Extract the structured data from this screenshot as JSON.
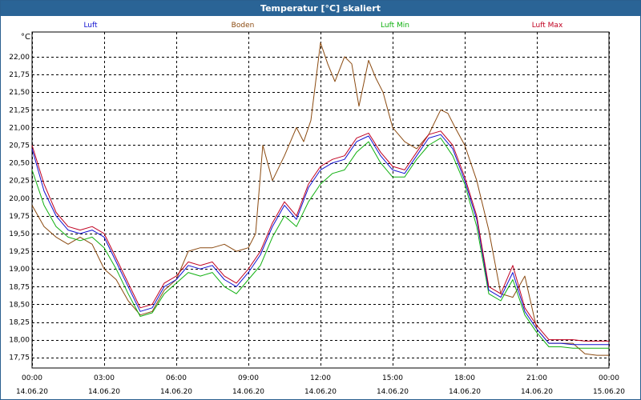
{
  "window": {
    "title": "Temperatur [°C] skaliert"
  },
  "colors": {
    "luft": "#1010d0",
    "boden": "#8b4a10",
    "luft_min": "#10b010",
    "luft_max": "#c00020"
  },
  "chart_data": {
    "type": "line",
    "title": "Temperatur [°C] skaliert",
    "ylabel": "°C",
    "xlabel": "",
    "ylim": [
      17.6,
      22.35
    ],
    "xlim": [
      0,
      24
    ],
    "grid": true,
    "legend": "top",
    "y_ticks": [
      "17,75",
      "18,00",
      "18,25",
      "18,50",
      "18,75",
      "19,00",
      "19,25",
      "19,50",
      "19,75",
      "20,00",
      "20,25",
      "20,50",
      "20,75",
      "21,00",
      "21,25",
      "21,50",
      "21,75",
      "22,00"
    ],
    "y_tick_values": [
      17.75,
      18.0,
      18.25,
      18.5,
      18.75,
      19.0,
      19.25,
      19.5,
      19.75,
      20.0,
      20.25,
      20.5,
      20.75,
      21.0,
      21.25,
      21.5,
      21.75,
      22.0
    ],
    "x_ticks": [
      {
        "x": 0,
        "time": "00:00",
        "date": "14.06.20"
      },
      {
        "x": 3,
        "time": "03:00",
        "date": "14.06.20"
      },
      {
        "x": 6,
        "time": "06:00",
        "date": "14.06.20"
      },
      {
        "x": 9,
        "time": "09:00",
        "date": "14.06.20"
      },
      {
        "x": 12,
        "time": "12:00",
        "date": "14.06.20"
      },
      {
        "x": 15,
        "time": "15:00",
        "date": "14.06.20"
      },
      {
        "x": 18,
        "time": "18:00",
        "date": "14.06.20"
      },
      {
        "x": 21,
        "time": "21:00",
        "date": "14.06.20"
      },
      {
        "x": 24,
        "time": "00:00",
        "date": "15.06.20"
      }
    ],
    "series": [
      {
        "name": "Luft",
        "color": "#1010d0",
        "x": [
          0,
          0.5,
          1,
          1.5,
          2,
          2.5,
          3,
          3.5,
          4,
          4.5,
          5,
          5.5,
          6,
          6.5,
          7,
          7.5,
          8,
          8.5,
          9,
          9.5,
          10,
          10.5,
          11,
          11.5,
          12,
          12.5,
          13,
          13.5,
          14,
          14.5,
          15,
          15.5,
          16,
          16.5,
          17,
          17.5,
          18,
          18.5,
          19,
          19.5,
          20,
          20.5,
          21,
          21.5,
          22,
          22.5,
          23,
          23.5,
          24
        ],
        "values": [
          20.7,
          20.1,
          19.75,
          19.55,
          19.5,
          19.55,
          19.45,
          19.1,
          18.75,
          18.4,
          18.45,
          18.75,
          18.85,
          19.05,
          19.0,
          19.05,
          18.85,
          18.75,
          18.95,
          19.2,
          19.6,
          19.9,
          19.7,
          20.15,
          20.4,
          20.5,
          20.55,
          20.8,
          20.88,
          20.6,
          20.4,
          20.35,
          20.6,
          20.85,
          20.9,
          20.7,
          20.25,
          19.7,
          18.7,
          18.6,
          18.95,
          18.4,
          18.15,
          17.95,
          17.95,
          17.93,
          17.93,
          17.93,
          17.93
        ]
      },
      {
        "name": "Boden",
        "color": "#8b4a10",
        "x": [
          0,
          0.5,
          1,
          1.5,
          2,
          2.5,
          3,
          3.5,
          4,
          4.5,
          5,
          5.5,
          6,
          6.5,
          7,
          7.5,
          8,
          8.5,
          9,
          9.3,
          9.6,
          10,
          10.5,
          11,
          11.3,
          11.6,
          12,
          12.3,
          12.6,
          13,
          13.3,
          13.6,
          14,
          14.3,
          14.6,
          15,
          15.5,
          16,
          16.5,
          17,
          17.3,
          17.6,
          18,
          18.5,
          19,
          19.5,
          20,
          20.5,
          21,
          21.5,
          22,
          22.5,
          23,
          23.5,
          24
        ],
        "values": [
          19.9,
          19.6,
          19.45,
          19.35,
          19.45,
          19.35,
          19.0,
          18.85,
          18.55,
          18.35,
          18.4,
          18.7,
          18.85,
          19.25,
          19.3,
          19.3,
          19.35,
          19.25,
          19.3,
          19.5,
          20.75,
          20.25,
          20.6,
          21.0,
          20.8,
          21.1,
          22.2,
          21.9,
          21.65,
          22.0,
          21.9,
          21.3,
          21.95,
          21.7,
          21.5,
          21.0,
          20.8,
          20.7,
          20.9,
          21.25,
          21.2,
          21.0,
          20.75,
          20.25,
          19.55,
          18.65,
          18.6,
          18.9,
          18.15,
          17.95,
          17.95,
          17.95,
          17.8,
          17.78,
          17.78
        ]
      },
      {
        "name": "Luft Min",
        "color": "#10b010",
        "x": [
          0,
          0.5,
          1,
          1.5,
          2,
          2.5,
          3,
          3.5,
          4,
          4.5,
          5,
          5.5,
          6,
          6.5,
          7,
          7.5,
          8,
          8.5,
          9,
          9.5,
          10,
          10.5,
          11,
          11.5,
          12,
          12.5,
          13,
          13.5,
          14,
          14.5,
          15,
          15.5,
          16,
          16.5,
          17,
          17.5,
          18,
          18.5,
          19,
          19.5,
          20,
          20.5,
          21,
          21.5,
          22,
          22.5,
          23,
          23.5,
          24
        ],
        "values": [
          20.4,
          19.9,
          19.6,
          19.45,
          19.4,
          19.45,
          19.3,
          19.0,
          18.65,
          18.33,
          18.38,
          18.65,
          18.8,
          18.95,
          18.9,
          18.95,
          18.75,
          18.65,
          18.85,
          19.05,
          19.45,
          19.75,
          19.6,
          19.95,
          20.2,
          20.35,
          20.4,
          20.65,
          20.8,
          20.5,
          20.3,
          20.3,
          20.55,
          20.75,
          20.85,
          20.6,
          20.2,
          19.6,
          18.65,
          18.55,
          18.85,
          18.35,
          18.1,
          17.9,
          17.9,
          17.88,
          17.88,
          17.88,
          17.88
        ]
      },
      {
        "name": "Luft Max",
        "color": "#c00020",
        "x": [
          0,
          0.5,
          1,
          1.5,
          2,
          2.5,
          3,
          3.5,
          4,
          4.5,
          5,
          5.5,
          6,
          6.5,
          7,
          7.5,
          8,
          8.5,
          9,
          9.5,
          10,
          10.5,
          11,
          11.5,
          12,
          12.5,
          13,
          13.5,
          14,
          14.5,
          15,
          15.5,
          16,
          16.5,
          17,
          17.5,
          18,
          18.5,
          19,
          19.5,
          20,
          20.5,
          21,
          21.5,
          22,
          22.5,
          23,
          23.5,
          24
        ],
        "values": [
          20.75,
          20.2,
          19.8,
          19.6,
          19.55,
          19.6,
          19.5,
          19.15,
          18.8,
          18.45,
          18.5,
          18.8,
          18.9,
          19.1,
          19.05,
          19.1,
          18.9,
          18.8,
          19.0,
          19.25,
          19.65,
          19.95,
          19.75,
          20.2,
          20.45,
          20.55,
          20.6,
          20.85,
          20.92,
          20.65,
          20.45,
          20.4,
          20.65,
          20.9,
          20.95,
          20.75,
          20.3,
          19.75,
          18.75,
          18.65,
          19.05,
          18.45,
          18.2,
          18.0,
          18.0,
          18.0,
          17.98,
          17.98,
          17.98
        ]
      }
    ]
  }
}
